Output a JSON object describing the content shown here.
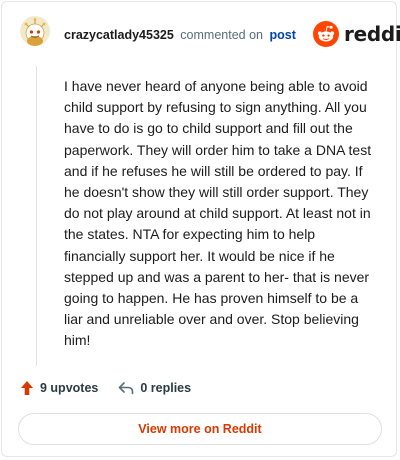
{
  "header": {
    "username": "crazycatlady45325",
    "action_text": "commented on",
    "post_link": "post",
    "brand_name": "reddit"
  },
  "comment": {
    "body": "I have never heard of anyone being able to avoid child support by refusing to sign anything. All you have to do is go to child support and fill out the paperwork. They will order him to take a DNA test and if he refuses he will still be ordered to pay. If he doesn't show they will still order support. They do not play around at child support. At least not in the states. NTA for expecting him to help financially support her. It would be nice if he stepped up and was a parent to her- that is never going to happen. He has proven himself to be a liar and unreliable over and over. Stop believing him!"
  },
  "footer": {
    "upvotes": "9 upvotes",
    "replies": "0 replies"
  },
  "cta": {
    "label": "View more on Reddit"
  },
  "icons": {
    "avatar": "snoo-avatar-icon",
    "brand": "reddit-logo-icon",
    "upvote": "upvote-arrow-icon",
    "reply": "reply-arrow-icon"
  },
  "colors": {
    "brand_orange": "#ff4500",
    "upvote_orange": "#d93900",
    "link_blue": "#0045ac",
    "cta_text": "#d93900"
  }
}
